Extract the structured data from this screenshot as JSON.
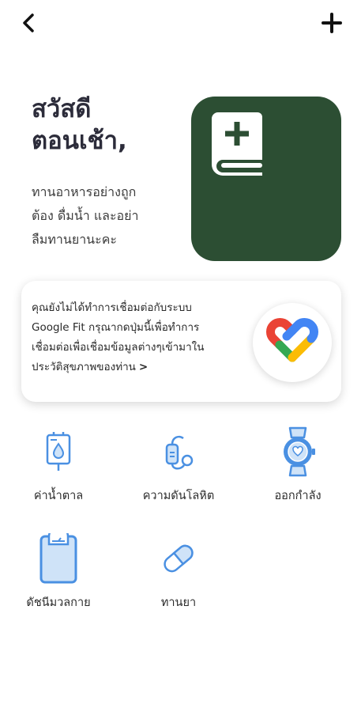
{
  "header": {
    "back_icon": "chevron-left-icon",
    "add_icon": "plus-icon"
  },
  "greeting": {
    "title_line1": "สวัสดี",
    "title_line2": "ตอนเช้า,",
    "message_line1": "ทานอาหารอย่างถูก",
    "message_line2": "ต้อง ดื่มน้ำ และอย่า",
    "message_line3": "ลืมทานยานะคะ"
  },
  "hero": {
    "icon": "medical-book-icon",
    "background_color": "#2c4e33"
  },
  "google_fit_card": {
    "line1": "คุณยังไม่ได้ทำการเชื่อมต่อกับระบบ",
    "line2": "Google Fit กรุณากดปุ่มนี้เพื่อทำการ",
    "line3": "เชื่อมต่อเพื่อเชื่อมข้อมูลต่างๆเข้ามาใน",
    "line4": "ประวัติสุขภาพของท่าน",
    "chevron": ">",
    "logo": "google-fit-heart-icon"
  },
  "menu": {
    "accent_color": "#4a90e2",
    "items": [
      {
        "label": "ค่าน้ำตาล",
        "icon": "blood-sugar-icon"
      },
      {
        "label": "ความดันโลหิต",
        "icon": "blood-pressure-icon"
      },
      {
        "label": "ออกกำลัง",
        "icon": "smartwatch-icon"
      },
      {
        "label": "ดัชนีมวลกาย",
        "icon": "weight-scale-icon"
      },
      {
        "label": "ทานยา",
        "icon": "pill-icon"
      }
    ]
  }
}
